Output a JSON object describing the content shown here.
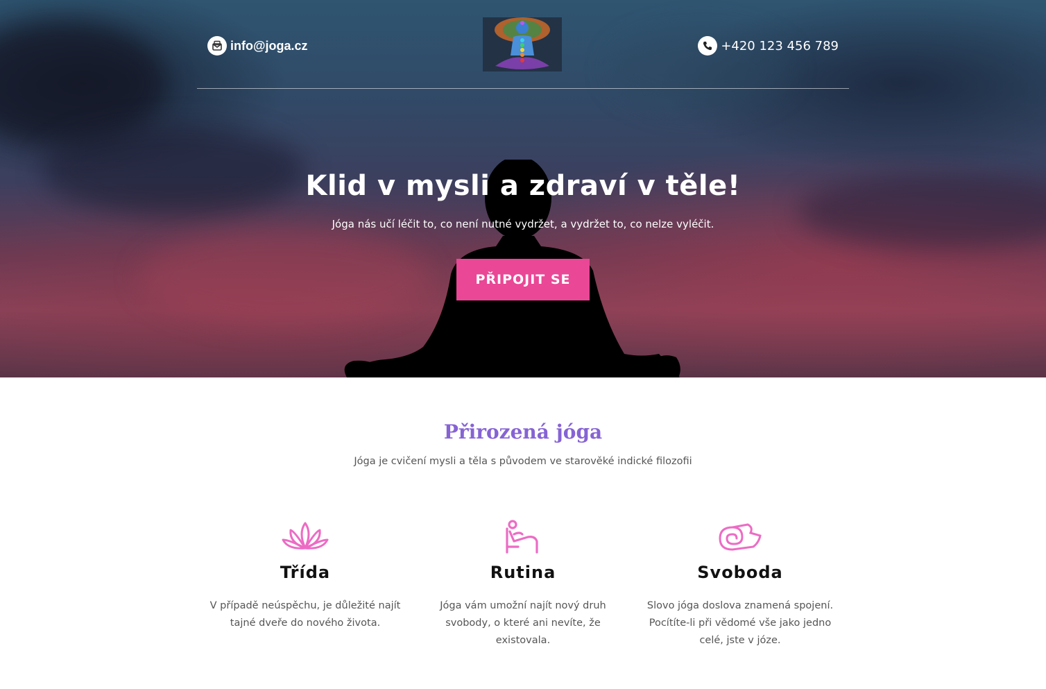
{
  "header": {
    "email": "info@joga.cz",
    "phone": "+420 123 456 789",
    "email_icon": "envelope-icon",
    "phone_icon": "phone-icon",
    "logo": "chakra-meditation-logo"
  },
  "hero": {
    "title": "Klid v mysli a zdraví v těle!",
    "subtitle": "Jóga nás učí léčit to, co není nutné vydržet, a vydržet to, co nelze vyléčit.",
    "cta_label": "PŘIPOJIT SE",
    "cta_color": "#ea4796"
  },
  "intro": {
    "title": "Přirozená jóga",
    "subtitle": "Jóga je cvičení mysli a těla s původem ve starověké indické filozofii",
    "title_color": "#8663d4"
  },
  "features": [
    {
      "icon": "lotus-icon",
      "title": "Třída",
      "text": "V případě neúspěchu, je důležité najít tajné dveře do nového života."
    },
    {
      "icon": "reclining-person-icon",
      "title": "Rutina",
      "text": "Jóga vám umožní najít nový druh svobody, o které ani nevíte, že existovala."
    },
    {
      "icon": "yoga-mat-icon",
      "title": "Svoboda",
      "text": "Slovo jóga doslova znamená spojení. Pocítíte-li při vědomé vše jako jedno celé, jste v józe."
    }
  ],
  "icon_color": "#ec6cc4"
}
